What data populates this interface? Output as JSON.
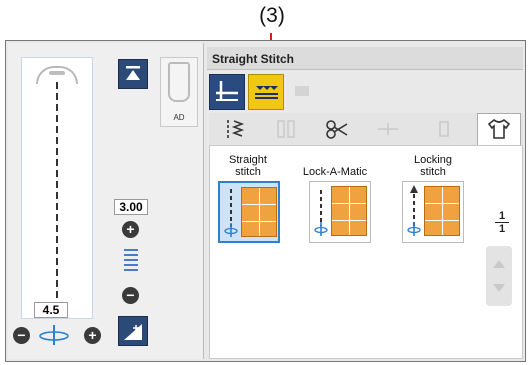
{
  "callout": {
    "label": "(3)"
  },
  "left_panel": {
    "needle_foot_label": "AD",
    "stitch_length": "3.00",
    "stitch_width": "4.5",
    "plus_symbol": "+",
    "minus_symbol": "−"
  },
  "right_panel": {
    "title": "Straight Stitch",
    "page_indicator": {
      "current": "1",
      "total": "1"
    },
    "stitches": [
      {
        "label_line1": "Straight",
        "label_line2": "stitch"
      },
      {
        "label_line1": "Lock-A-Matic",
        "label_line2": ""
      },
      {
        "label_line1": "Locking",
        "label_line2": "stitch"
      }
    ]
  },
  "colors": {
    "accent_blue": "#2a4b80",
    "accent_yellow": "#f0c814",
    "callout_red": "#d81b1b",
    "grid_orange": "#f0a240",
    "selected_blue": "#2f7fcf"
  }
}
